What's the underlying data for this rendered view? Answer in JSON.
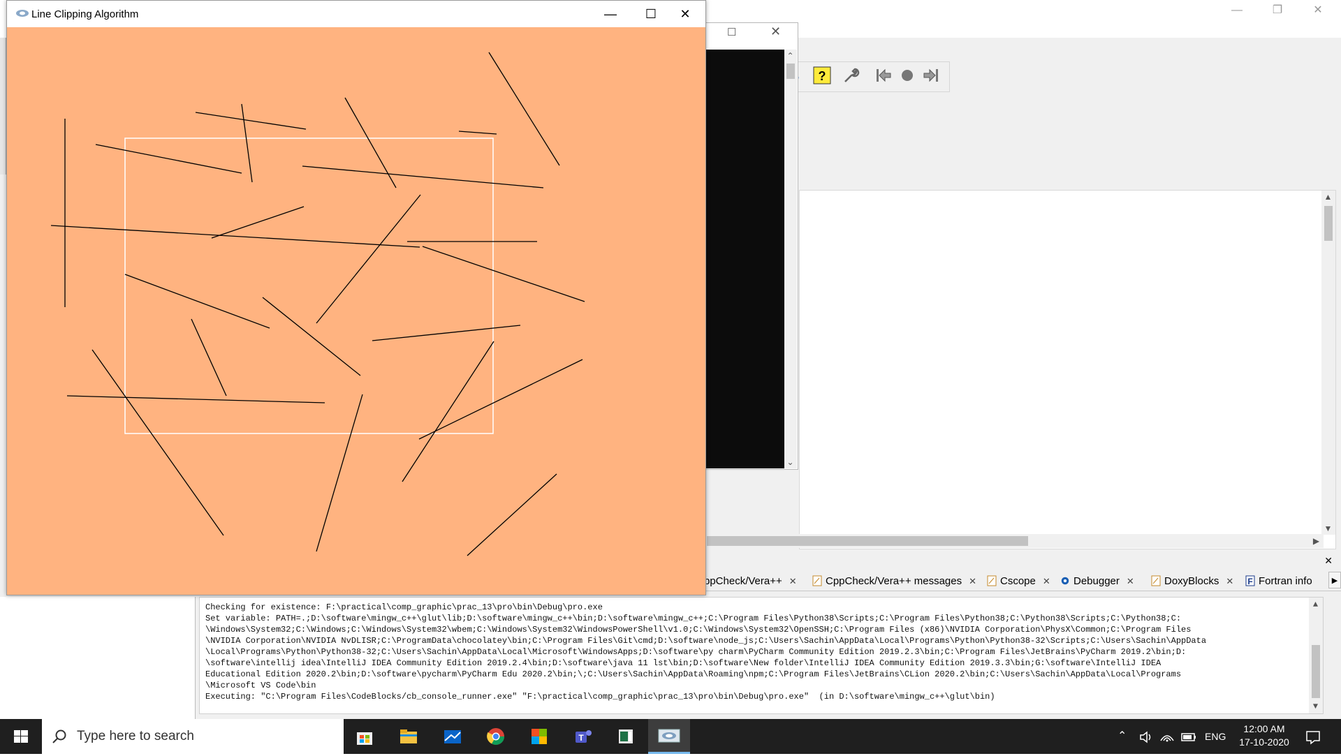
{
  "window": {
    "title": "Line Clipping Algorithm",
    "minimize_icon": "minimize-icon",
    "maximize_icon": "maximize-icon",
    "close_icon": "close-icon"
  },
  "colors": {
    "canvas_background": "#ffb380",
    "clip_window": "#ffffff",
    "line": "#000000"
  },
  "messages": {
    "tabs": [
      {
        "label": "ppCheck/Vera++",
        "icon": "none"
      },
      {
        "label": "CppCheck/Vera++ messages",
        "icon": "note-icon"
      },
      {
        "label": "Cscope",
        "icon": "note-icon"
      },
      {
        "label": "Debugger",
        "icon": "gear-icon"
      },
      {
        "label": "DoxyBlocks",
        "icon": "note-icon"
      },
      {
        "label": "Fortran info",
        "icon": "fortran-icon"
      }
    ],
    "log": [
      "Checking for existence: F:\\practical\\comp_graphic\\prac_13\\pro\\bin\\Debug\\pro.exe",
      "Set variable: PATH=.;D:\\software\\mingw_c++\\glut\\lib;D:\\software\\mingw_c++\\bin;D:\\software\\mingw_c++;C:\\Program Files\\Python38\\Scripts;C:\\Program Files\\Python38;C:\\Python38\\Scripts;C:\\Python38;C:",
      "\\Windows\\System32;C:\\Windows;C:\\Windows\\System32\\wbem;C:\\Windows\\System32\\WindowsPowerShell\\v1.0;C:\\Windows\\System32\\OpenSSH;C:\\Program Files (x86)\\NVIDIA Corporation\\PhysX\\Common;C:\\Program Files",
      "\\NVIDIA Corporation\\NVIDIA NvDLISR;C:\\ProgramData\\chocolatey\\bin;C:\\Program Files\\Git\\cmd;D:\\software\\node_js;C:\\Users\\Sachin\\AppData\\Local\\Programs\\Python\\Python38-32\\Scripts;C:\\Users\\Sachin\\AppData",
      "\\Local\\Programs\\Python\\Python38-32;C:\\Users\\Sachin\\AppData\\Local\\Microsoft\\WindowsApps;D:\\software\\py charm\\PyCharm Community Edition 2019.2.3\\bin;C:\\Program Files\\JetBrains\\PyCharm 2019.2\\bin;D:",
      "\\software\\intellij idea\\IntelliJ IDEA Community Edition 2019.2.4\\bin;D:\\software\\java 11 lst\\bin;D:\\software\\New folder\\IntelliJ IDEA Community Edition 2019.3.3\\bin;G:\\software\\IntelliJ IDEA",
      "Educational Edition 2020.2\\bin;D:\\software\\pycharm\\PyCharm Edu 2020.2\\bin;\\;C:\\Users\\Sachin\\AppData\\Roaming\\npm;C:\\Program Files\\JetBrains\\CLion 2020.2\\bin;C:\\Users\\Sachin\\AppData\\Local\\Programs",
      "\\Microsoft VS Code\\bin",
      "Executing: \"C:\\Program Files\\CodeBlocks/cb_console_runner.exe\" \"F:\\practical\\comp_graphic\\prac_13\\pro\\bin\\Debug\\pro.exe\"  (in D:\\software\\mingw_c++\\glut\\bin)"
    ]
  },
  "taskbar": {
    "search_placeholder": "Type here to search",
    "language": "ENG",
    "time": "12:00 AM",
    "date": "17-10-2020",
    "apps": [
      "store-icon",
      "file-explorer-icon",
      "mail-icon",
      "chrome-icon",
      "office-icon",
      "teams-icon",
      "notepad-icon",
      "codeblocks-icon"
    ]
  }
}
